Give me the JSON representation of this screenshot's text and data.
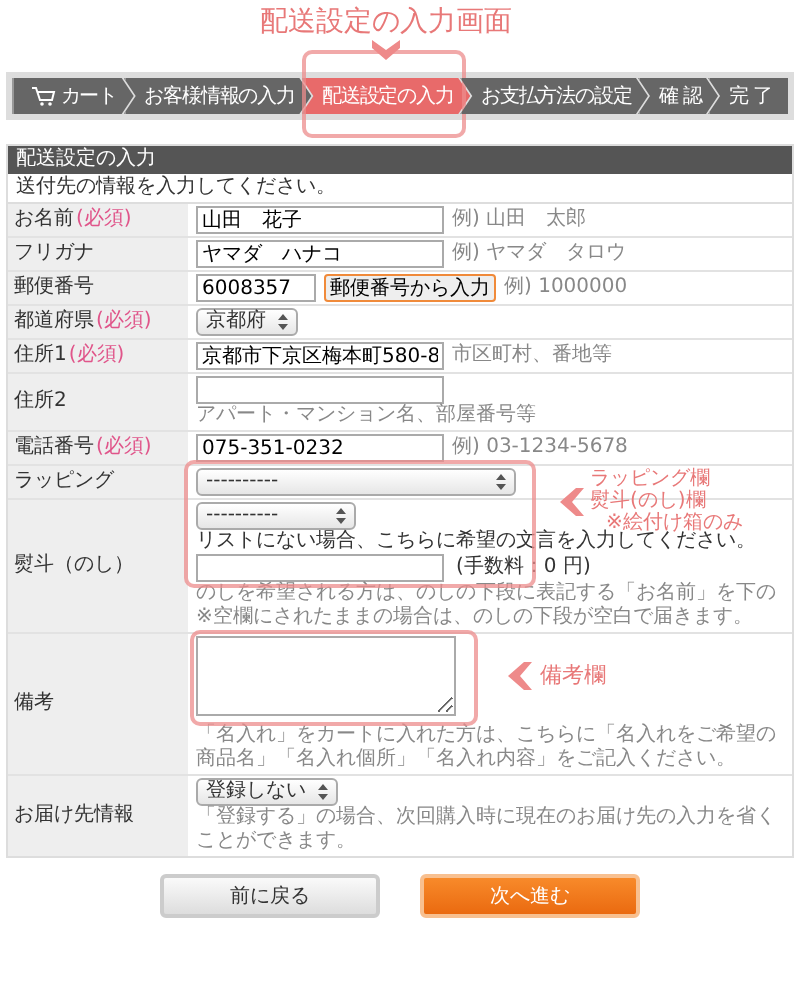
{
  "annotations": {
    "title": "配送設定の入力画面",
    "wrapping_lines": [
      "ラッピング欄",
      "熨斗(のし)欄",
      "※絵付け箱のみ"
    ],
    "remarks": "備考欄"
  },
  "steps": [
    {
      "label": "カート",
      "selected": false
    },
    {
      "label": "お客様情報の入力",
      "selected": false
    },
    {
      "label": "配送設定の入力",
      "selected": true
    },
    {
      "label": "お支払方法の設定",
      "selected": false
    },
    {
      "label": "確 認",
      "selected": false
    },
    {
      "label": "完 了",
      "selected": false
    }
  ],
  "form": {
    "title": "配送設定の入力",
    "intro": "送付先の情報を入力してください。",
    "rows": [
      {
        "kind": "text",
        "label": "お名前",
        "required": "(必須)",
        "value": "山田　花子",
        "hint": "例) 山田　太郎"
      },
      {
        "kind": "text",
        "label": "フリガナ",
        "value": "ヤマダ　ハナコ",
        "hint": "例) ヤマダ　タロウ"
      },
      {
        "kind": "zip",
        "label": "郵便番号",
        "value": "6008357",
        "button": "郵便番号から入力",
        "hint": "例) 1000000"
      },
      {
        "kind": "select",
        "label": "都道府県",
        "required": "(必須)",
        "value": "京都府"
      },
      {
        "kind": "text",
        "label": "住所1",
        "required": "(必須)",
        "value": "京都市下京区梅本町580-8",
        "hint": "市区町村、番地等"
      },
      {
        "kind": "text",
        "label": "住所2",
        "hint": "アパート・マンション名、部屋番号等"
      },
      {
        "kind": "text",
        "label": "電話番号",
        "required": "(必須)",
        "value": "075-351-0232",
        "hint": "例) 03-1234-5678"
      },
      {
        "kind": "wrapping",
        "label": "ラッピング",
        "value": "----------"
      },
      {
        "kind": "noshi",
        "label": "熨斗（のし）",
        "value": "----------",
        "instruction": "リストにない場合、こちらに希望の文言を入力してください。",
        "fee": "(手数料：0 円)",
        "notes": [
          "のしを希望される方は、のしの下段に表記する「お名前」を下の",
          "※空欄にされたままの場合は、のしの下段が空白で届きます。"
        ]
      },
      {
        "kind": "textarea",
        "label": "備考",
        "note": "「名入れ」をカートに入れた方は、こちらに「名入れをご希望の商品名」「名入れ個所」「名入れ内容」をご記入ください。"
      },
      {
        "kind": "register",
        "label": "お届け先情報",
        "value": "登録しない",
        "note": "「登録する」の場合、次回購入時に現在のお届け先の入力を省くことができます。"
      }
    ]
  },
  "buttons": [
    {
      "label": "前に戻る",
      "kind": "secondary"
    },
    {
      "label": "次へ進む",
      "kind": "primary"
    }
  ]
}
